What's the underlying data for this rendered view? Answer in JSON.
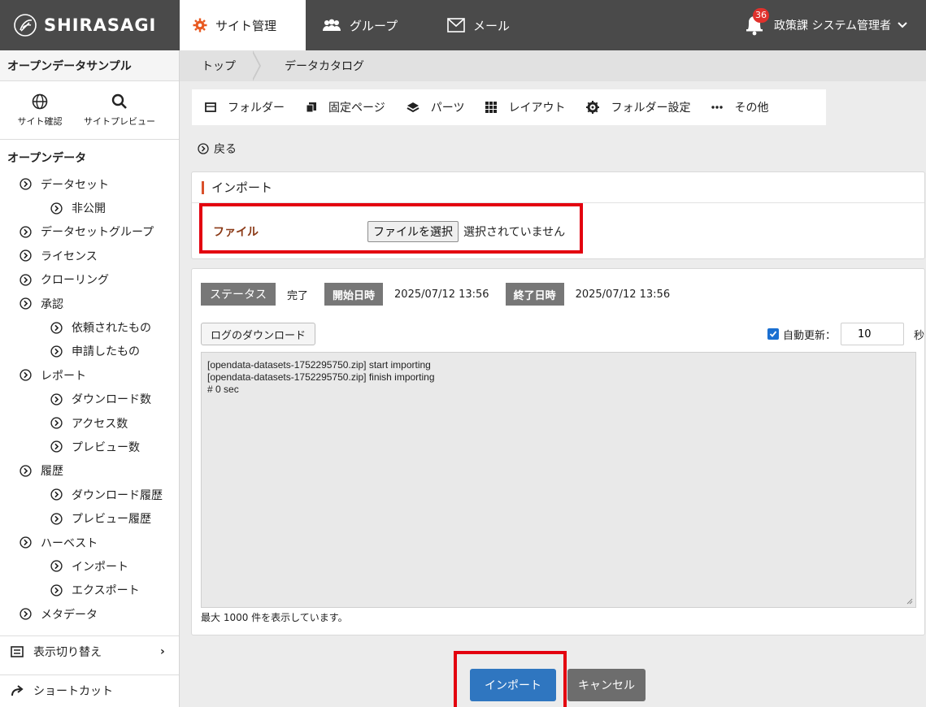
{
  "header": {
    "brand": "SHIRASAGI",
    "tabs": [
      {
        "label": "サイト管理",
        "icon": "gear-icon",
        "active": true
      },
      {
        "label": "グループ",
        "icon": "users-icon",
        "active": false
      },
      {
        "label": "メール",
        "icon": "mail-icon",
        "active": false
      }
    ],
    "notifications": "36",
    "user": "政策課 システム管理者"
  },
  "sidebar": {
    "site_name": "オープンデータサンプル",
    "tools": [
      {
        "label": "サイト確認",
        "icon": "globe-icon"
      },
      {
        "label": "サイトプレビュー",
        "icon": "search-icon"
      }
    ],
    "section": "オープンデータ",
    "items": [
      {
        "label": "データセット",
        "level": 1
      },
      {
        "label": "非公開",
        "level": 2
      },
      {
        "label": "データセットグループ",
        "level": 1
      },
      {
        "label": "ライセンス",
        "level": 1
      },
      {
        "label": "クローリング",
        "level": 1
      },
      {
        "label": "承認",
        "level": 1
      },
      {
        "label": "依頼されたもの",
        "level": 2
      },
      {
        "label": "申請したもの",
        "level": 2
      },
      {
        "label": "レポート",
        "level": 1
      },
      {
        "label": "ダウンロード数",
        "level": 2
      },
      {
        "label": "アクセス数",
        "level": 2
      },
      {
        "label": "プレビュー数",
        "level": 2
      },
      {
        "label": "履歴",
        "level": 1
      },
      {
        "label": "ダウンロード履歴",
        "level": 2
      },
      {
        "label": "プレビュー履歴",
        "level": 2
      },
      {
        "label": "ハーベスト",
        "level": 1
      },
      {
        "label": "インポート",
        "level": 2
      },
      {
        "label": "エクスポート",
        "level": 2
      },
      {
        "label": "メタデータ",
        "level": 1
      }
    ],
    "footer": [
      {
        "label": "表示切り替え",
        "icon": "display-toggle-icon"
      },
      {
        "label": "ショートカット",
        "icon": "share-arrow-icon"
      }
    ]
  },
  "breadcrumb": {
    "home": "トップ",
    "current": "データカタログ"
  },
  "toolbar": [
    {
      "label": "フォルダー",
      "icon": "folder-icon"
    },
    {
      "label": "固定ページ",
      "icon": "pages-icon"
    },
    {
      "label": "パーツ",
      "icon": "layers-icon"
    },
    {
      "label": "レイアウト",
      "icon": "grid-icon"
    },
    {
      "label": "フォルダー設定",
      "icon": "settings-icon"
    },
    {
      "label": "その他",
      "icon": "more-icon"
    }
  ],
  "back_label": "戻る",
  "import_card": {
    "title": "インポート",
    "file_label": "ファイル",
    "file_button": "ファイルを選択",
    "file_status": "選択されていません"
  },
  "log_card": {
    "status_tag": "ステータス",
    "status_value": "完了",
    "start_tag": "開始日時",
    "start_value": "2025/07/12 13:56",
    "end_tag": "終了日時",
    "end_value": "2025/07/12 13:56",
    "download_button": "ログのダウンロード",
    "auto_refresh_label": "自動更新：",
    "auto_refresh_checked": true,
    "auto_refresh_seconds": "10",
    "seconds_unit": "秒",
    "log_lines": [
      "[opendata-datasets-1752295750.zip] start importing",
      "[opendata-datasets-1752295750.zip] finish importing",
      "# 0 sec"
    ],
    "note": "最大 1000 件を表示しています。"
  },
  "actions": {
    "import": "インポート",
    "cancel": "キャンセル"
  },
  "colors": {
    "header_bg": "#4a4a4a",
    "accent_red": "#e3000f",
    "primary": "#2f76c0",
    "badge": "#e0312c"
  }
}
